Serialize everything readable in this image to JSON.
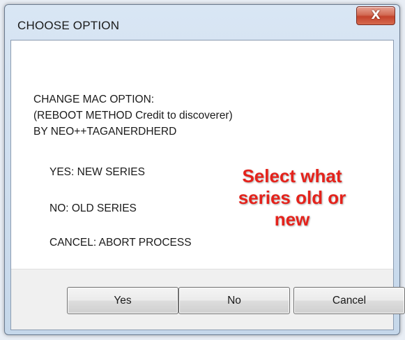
{
  "window": {
    "title": "CHOOSE OPTION",
    "close_glyph": "X"
  },
  "message": {
    "lines": [
      "CHANGE MAC OPTION:",
      "(REBOOT METHOD Credit to discoverer)",
      "BY NEO++TAGANERDHERD"
    ]
  },
  "options": {
    "yes": "YES:  NEW SERIES",
    "no": "NO:  OLD SERIES",
    "cancel": "CANCEL:  ABORT PROCESS"
  },
  "annotation": {
    "lines": [
      "Select what",
      "series old or",
      "new"
    ],
    "color": "#e5221b"
  },
  "buttons": {
    "yes": "Yes",
    "no": "No",
    "cancel": "Cancel"
  },
  "colors": {
    "close_button": "#c4432c",
    "dialog_frame": "#c5d7ea",
    "button_bar": "#f0f0f0"
  }
}
